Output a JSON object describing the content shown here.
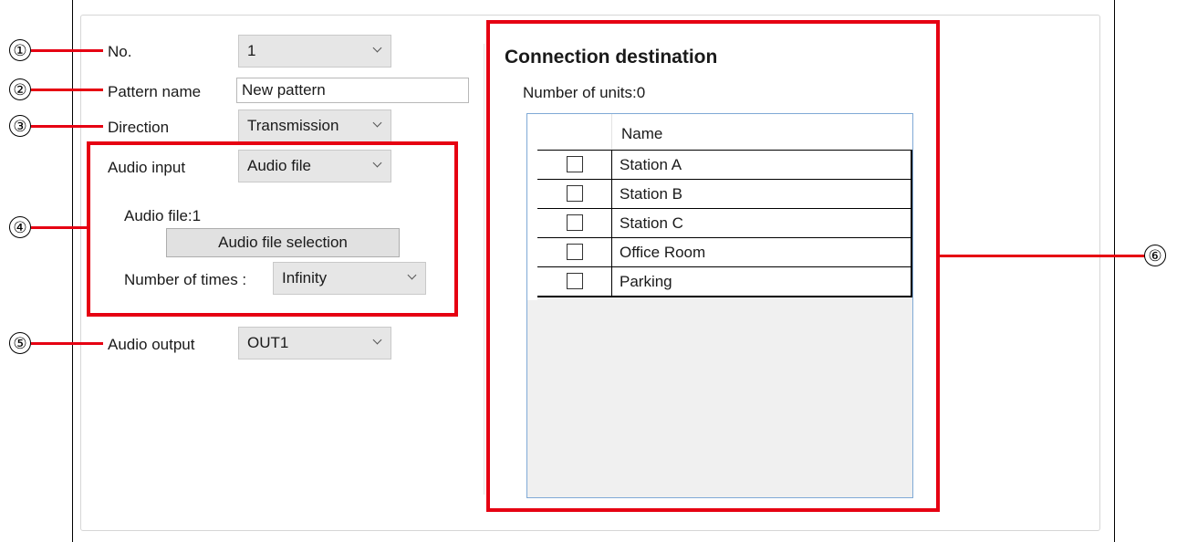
{
  "fields": {
    "no_label": "No.",
    "no_value": "1",
    "pattern_name_label": "Pattern name",
    "pattern_name_value": "New pattern",
    "direction_label": "Direction",
    "direction_value": "Transmission",
    "audio_input_label": "Audio input",
    "audio_input_value": "Audio file",
    "audio_file_text": "Audio file:1",
    "audio_file_selection_button": "Audio file selection",
    "number_of_times_label": "Number of times :",
    "number_of_times_value": "Infinity",
    "audio_output_label": "Audio output",
    "audio_output_value": "OUT1"
  },
  "connection": {
    "title": "Connection destination",
    "units_text": "Number of units:0",
    "column_name": "Name",
    "rows": [
      {
        "name": "Station A",
        "checked": false
      },
      {
        "name": "Station B",
        "checked": false
      },
      {
        "name": "Station C",
        "checked": false
      },
      {
        "name": "Office Room",
        "checked": false
      },
      {
        "name": "Parking",
        "checked": false
      }
    ]
  },
  "callouts": [
    "①",
    "②",
    "③",
    "④",
    "⑤",
    "⑥"
  ],
  "colors": {
    "callout_red": "#e60012",
    "combo_bg": "#e6e6e6",
    "grid_border": "#7fa9d6"
  }
}
